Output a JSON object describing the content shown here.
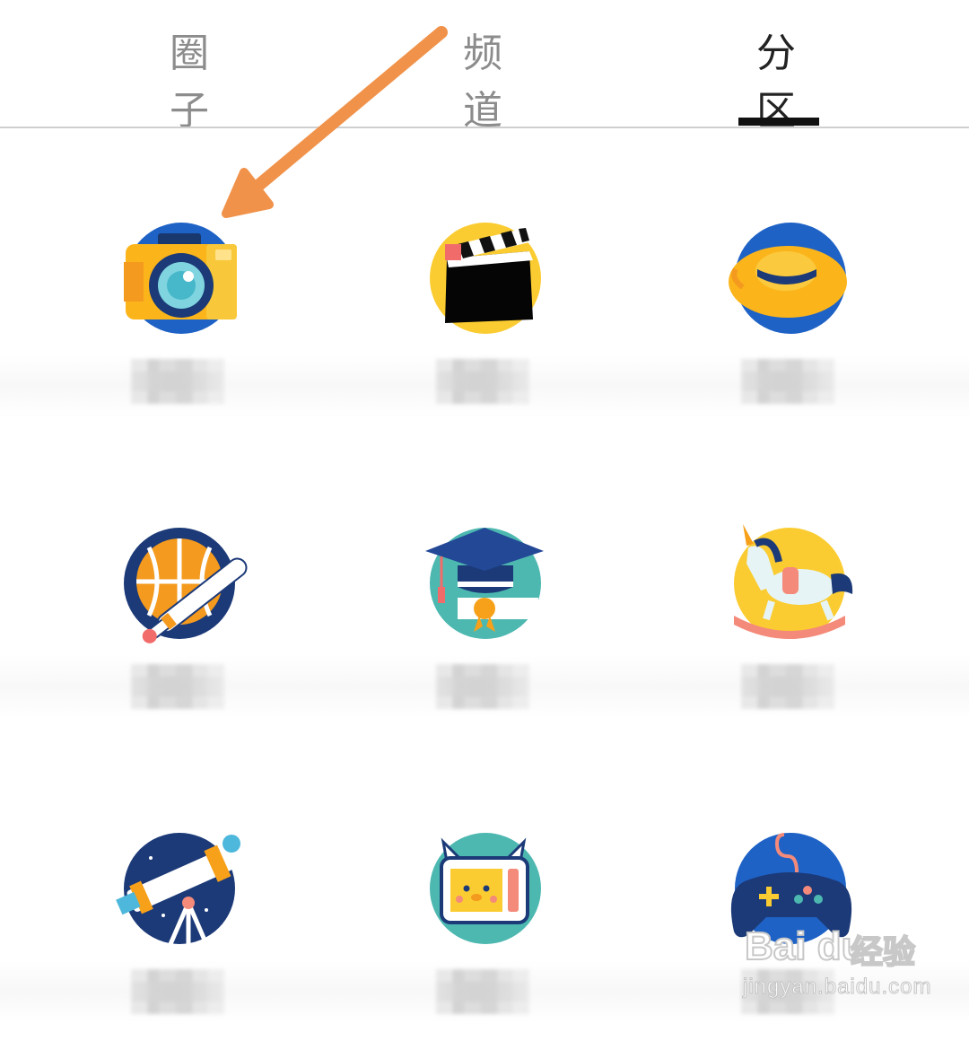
{
  "tabs": [
    {
      "label": "圈子",
      "active": false
    },
    {
      "label": "频道",
      "active": false
    },
    {
      "label": "分区",
      "active": true
    }
  ],
  "categories": [
    {
      "icon": "camera-icon",
      "label": ""
    },
    {
      "icon": "clapperboard-icon",
      "label": ""
    },
    {
      "icon": "sun-hat-icon",
      "label": ""
    },
    {
      "icon": "basketball-bat-icon",
      "label": ""
    },
    {
      "icon": "graduation-cap-icon",
      "label": ""
    },
    {
      "icon": "rocking-unicorn-icon",
      "label": ""
    },
    {
      "icon": "telescope-icon",
      "label": ""
    },
    {
      "icon": "cat-tv-icon",
      "label": ""
    },
    {
      "icon": "gamepad-icon",
      "label": ""
    }
  ],
  "annotation": {
    "type": "arrow",
    "color": "#f0924a",
    "points_to": "camera-icon"
  },
  "watermark": {
    "brand": "Bai du",
    "brand_cn": "经验",
    "url": "jingyan.baidu.com"
  }
}
